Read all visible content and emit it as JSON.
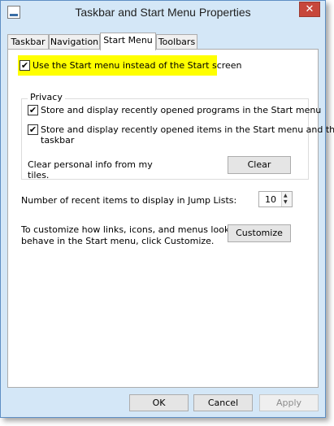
{
  "window": {
    "title": "Taskbar and Start Menu Properties",
    "close_glyph": "✕"
  },
  "tabs": [
    {
      "label": "Taskbar"
    },
    {
      "label": "Navigation"
    },
    {
      "label": "Start Menu",
      "active": true
    },
    {
      "label": "Toolbars"
    }
  ],
  "start_menu": {
    "use_start_menu_label": "Use the Start menu instead of the Start screen",
    "use_start_menu_checked": true,
    "privacy": {
      "title": "Privacy",
      "recent_programs_label": "Store and display recently opened programs in the Start menu",
      "recent_programs_checked": true,
      "recent_items_label_line1": "Store and display recently opened items in the Start menu and the",
      "recent_items_label_line2": "taskbar",
      "recent_items_checked": true,
      "clear_label_line1": "Clear personal info from my",
      "clear_label_line2": "tiles.",
      "clear_button": "Clear"
    },
    "jump_lists": {
      "label": "Number of recent items to display in Jump Lists:",
      "value": "10"
    },
    "customize": {
      "text_line1": "To customize how links, icons, and menus look and",
      "text_line2": "behave in the Start menu, click Customize.",
      "button": "Customize"
    }
  },
  "footer": {
    "ok": "OK",
    "cancel": "Cancel",
    "apply": "Apply"
  },
  "colors": {
    "highlight": "#ffff00",
    "title_bar": "#d4e7f7",
    "close_button": "#c7473b"
  },
  "icons": {
    "check": "✔",
    "spin_up": "▲",
    "spin_down": "▼"
  }
}
